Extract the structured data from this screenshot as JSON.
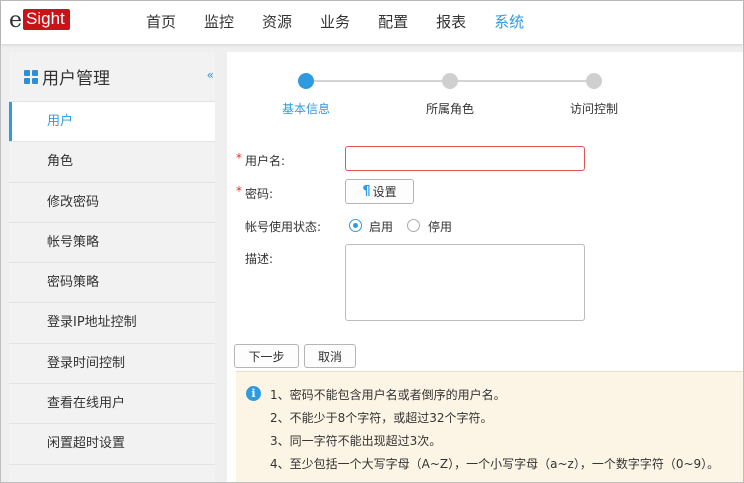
{
  "app": {
    "logo_e": "e",
    "logo_box": "Sight"
  },
  "nav": [
    "首页",
    "监控",
    "资源",
    "业务",
    "配置",
    "报表",
    "系统"
  ],
  "sidebar": {
    "title": "用户管理",
    "collapse_glyph": "«",
    "items": [
      "用户",
      "角色",
      "修改密码",
      "帐号策略",
      "密码策略",
      "登录IP地址控制",
      "登录时间控制",
      "查看在线用户",
      "闲置超时设置"
    ]
  },
  "steps": [
    "基本信息",
    "所属角色",
    "访问控制"
  ],
  "form": {
    "required_mark": "*",
    "username_label": "用户名:",
    "password_label": "密码:",
    "set_button": "设置",
    "status_label": "帐号使用状态:",
    "enable_label": "启用",
    "disable_label": "停用",
    "desc_label": "描述:"
  },
  "buttons": {
    "next": "下一步",
    "cancel": "取消"
  },
  "tips": [
    "1、密码不能包含用户名或者倒序的用户名。",
    "2、不能少于8个字符，或超过32个字符。",
    "3、同一字符不能出现超过3次。",
    "4、至少包括一个大写字母（A~Z），一个小写字母（a~z），一个数字字符（0~9）。"
  ],
  "info_glyph": "i",
  "key_glyph": "¶",
  "colors": {
    "accent": "#2e9be0",
    "brand_red": "#c7141a",
    "required": "#e0302b"
  }
}
